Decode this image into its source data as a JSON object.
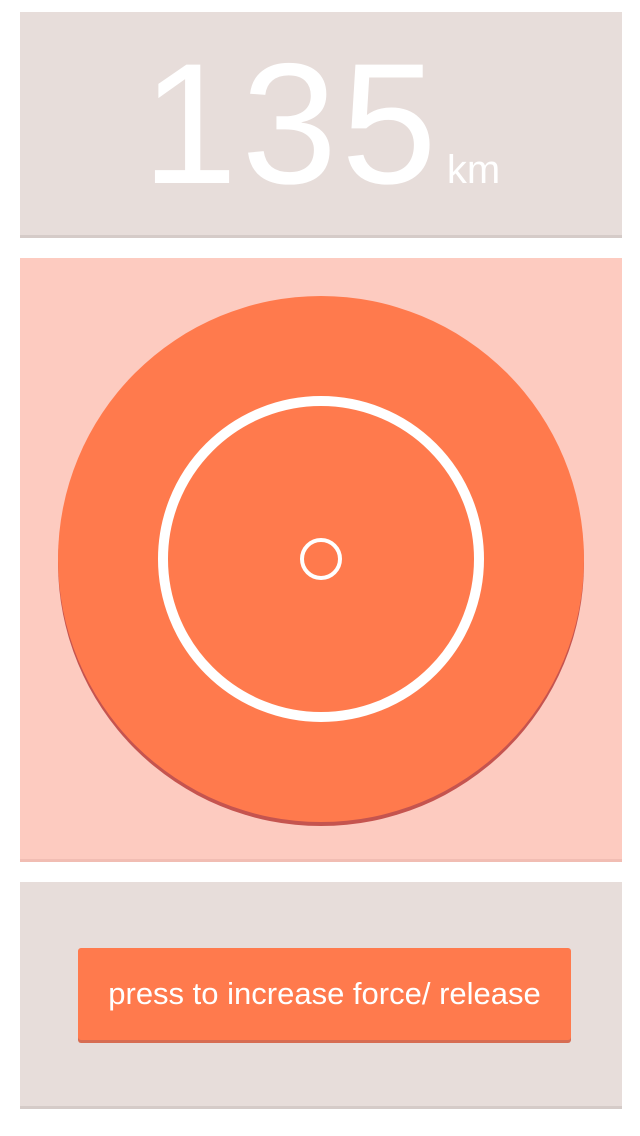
{
  "distance": {
    "value": "135",
    "unit": "km"
  },
  "controls": {
    "force_button_label": "press to increase force/ release"
  },
  "colors": {
    "panel_gray": "#e7ddda",
    "target_background": "#fdcbc0",
    "accent_orange": "#ff7a4d",
    "white": "#ffffff"
  }
}
